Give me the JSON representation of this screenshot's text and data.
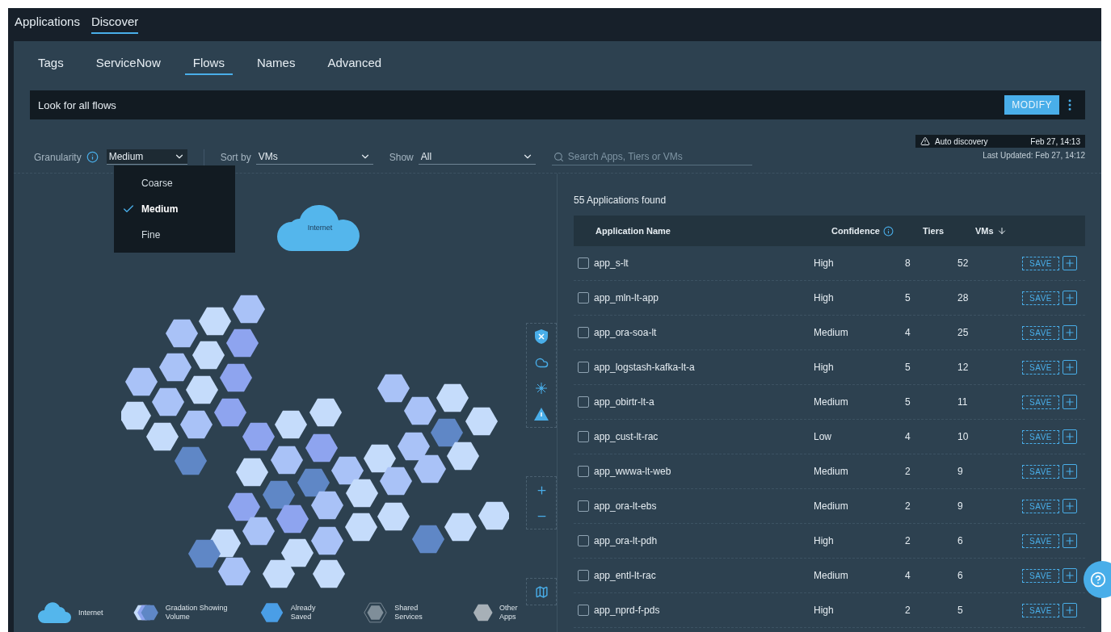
{
  "nav": {
    "tabs": [
      {
        "label": "Applications",
        "selected": false
      },
      {
        "label": "Discover",
        "selected": true
      }
    ]
  },
  "subtabs": [
    {
      "label": "Tags",
      "selected": false
    },
    {
      "label": "ServiceNow",
      "selected": false
    },
    {
      "label": "Flows",
      "selected": true
    },
    {
      "label": "Names",
      "selected": false
    },
    {
      "label": "Advanced",
      "selected": false
    }
  ],
  "query": {
    "text": "Look for all flows",
    "button": "MODIFY"
  },
  "filters": {
    "granularity": {
      "label": "Granularity",
      "value": "Medium",
      "options": [
        {
          "label": "Coarse",
          "selected": false
        },
        {
          "label": "Medium",
          "selected": true
        },
        {
          "label": "Fine",
          "selected": false
        }
      ]
    },
    "sort": {
      "label": "Sort by",
      "value": "VMs"
    },
    "show": {
      "label": "Show",
      "value": "All"
    },
    "search": {
      "placeholder": "Search Apps, Tiers or VMs"
    }
  },
  "discovery": {
    "label": "Auto discovery",
    "time": "Feb 27, 14:13",
    "last_updated": "Last Updated: Feb 27, 14:12"
  },
  "map": {
    "cloud_label": "Internet"
  },
  "legend": [
    {
      "kind": "cloud",
      "label": "Internet"
    },
    {
      "kind": "gradation",
      "label": "Gradation Showing Volume"
    },
    {
      "kind": "saved",
      "label": "Already Saved"
    },
    {
      "kind": "shared",
      "label": "Shared Services"
    },
    {
      "kind": "other",
      "label": "Other Apps"
    }
  ],
  "results": {
    "count": "55 Applications found",
    "columns": [
      "Application Name",
      "Confidence",
      "Tiers",
      "VMs"
    ],
    "rows": [
      {
        "name": "app_s-lt",
        "confidence": "High",
        "tiers": "8",
        "vms": "52",
        "action": "SAVE",
        "checked": false
      },
      {
        "name": "app_mln-lt-app",
        "confidence": "High",
        "tiers": "5",
        "vms": "28",
        "action": "SAVE",
        "checked": false
      },
      {
        "name": "app_ora-soa-lt",
        "confidence": "Medium",
        "tiers": "4",
        "vms": "25",
        "action": "SAVE",
        "checked": false
      },
      {
        "name": "app_logstash-kafka-lt-a",
        "confidence": "High",
        "tiers": "5",
        "vms": "12",
        "action": "SAVE",
        "checked": false
      },
      {
        "name": "app_obirtr-lt-a",
        "confidence": "Medium",
        "tiers": "5",
        "vms": "11",
        "action": "SAVE",
        "checked": false
      },
      {
        "name": "app_cust-lt-rac",
        "confidence": "Low",
        "tiers": "4",
        "vms": "10",
        "action": "SAVE",
        "checked": false
      },
      {
        "name": "app_wwwa-lt-web",
        "confidence": "Medium",
        "tiers": "2",
        "vms": "9",
        "action": "SAVE",
        "checked": false
      },
      {
        "name": "app_ora-lt-ebs",
        "confidence": "Medium",
        "tiers": "2",
        "vms": "9",
        "action": "SAVE",
        "checked": false
      },
      {
        "name": "app_ora-lt-pdh",
        "confidence": "High",
        "tiers": "2",
        "vms": "6",
        "action": "SAVE",
        "checked": false
      },
      {
        "name": "app_entl-lt-rac",
        "confidence": "Medium",
        "tiers": "4",
        "vms": "6",
        "action": "SAVE",
        "checked": false
      },
      {
        "name": "app_nprd-f-pds",
        "confidence": "High",
        "tiers": "2",
        "vms": "5",
        "action": "SAVE",
        "checked": false
      }
    ]
  }
}
